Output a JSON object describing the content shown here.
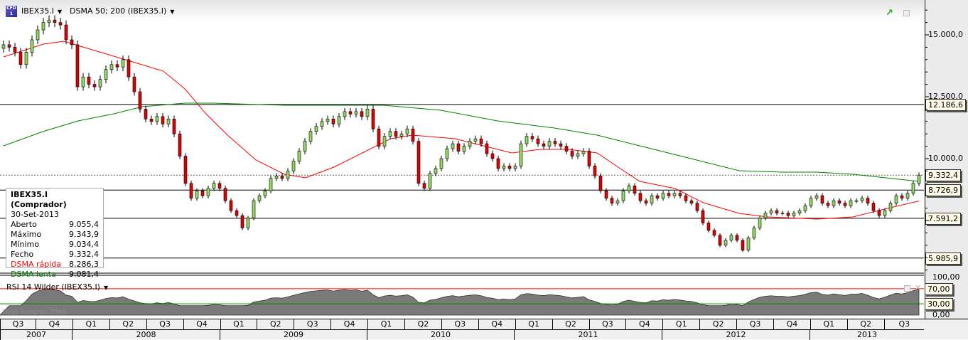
{
  "header": {
    "symbol": "IBEX35.I",
    "indicator": "DSMA 50; 200 (IBEX35.I)",
    "icon": "cfd-icon"
  },
  "infobox": {
    "title": "IBEX35.I (Comprador)",
    "date": "30-Set-2013",
    "rows": [
      {
        "label": "Aberto",
        "value": "9.055,4"
      },
      {
        "label": "Máximo",
        "value": "9.343,9"
      },
      {
        "label": "Mínimo",
        "value": "9.034,4"
      },
      {
        "label": "Fecho",
        "value": "9.332,4"
      },
      {
        "label": "DSMA rápida",
        "value": "8.286,3",
        "color": "#ff0000"
      },
      {
        "label": "DSMA lenta",
        "value": "9.081,4",
        "color": "#008000"
      }
    ]
  },
  "rsi": {
    "title": "RSI 14 Wilder (IBEX35.I)",
    "timezone": "Fuso horário: TMG",
    "axis": [
      "100,00",
      "0,00"
    ],
    "levels": [
      {
        "value": 70,
        "label": "70,00",
        "color": "#ff0000"
      },
      {
        "value": 30,
        "label": "30,00",
        "color": "#008000"
      }
    ]
  },
  "time_axis": {
    "quarters": [
      "Q3",
      "Q4",
      "Q1",
      "Q2",
      "Q3",
      "Q4",
      "Q1",
      "Q2",
      "Q3",
      "Q4",
      "Q1",
      "Q2",
      "Q3",
      "Q4",
      "Q1",
      "Q2",
      "Q3",
      "Q4",
      "Q1",
      "Q2",
      "Q3",
      "Q4",
      "Q1",
      "Q2",
      "Q3"
    ],
    "years": [
      "2007",
      "2008",
      "2009",
      "2010",
      "2011",
      "2012",
      "2013"
    ]
  },
  "chart_data": {
    "type": "candlestick",
    "interval": "biweekly (approx.)",
    "y_ticks": [
      {
        "value": 15000,
        "label": "15.000,0"
      },
      {
        "value": 12500,
        "label": "12.500,0"
      },
      {
        "value": 10000,
        "label": "10.000,0"
      }
    ],
    "horizontal_lines": [
      {
        "value": 12186.6,
        "label": "12.186,6"
      },
      {
        "value": 8726.9,
        "label": "8.726,9"
      },
      {
        "value": 7591.2,
        "label": "7.591,2"
      },
      {
        "value": 5985.9,
        "label": "5.985,9"
      }
    ],
    "last_price": {
      "value": 9332.4,
      "label": "9.332,4"
    },
    "closes": [
      14600,
      14500,
      14300,
      13800,
      14300,
      14800,
      15200,
      15500,
      15600,
      15500,
      15400,
      14800,
      14600,
      12900,
      13300,
      13000,
      12900,
      13200,
      13600,
      13800,
      13700,
      14000,
      13300,
      12700,
      12000,
      11600,
      11500,
      11700,
      11400,
      11600,
      11000,
      10100,
      9000,
      8400,
      8700,
      8500,
      8800,
      9000,
      8800,
      8300,
      7900,
      7700,
      7200,
      7600,
      8300,
      8500,
      8700,
      9200,
      9300,
      9200,
      9500,
      9900,
      10300,
      10700,
      11100,
      11300,
      11500,
      11600,
      11400,
      11700,
      11900,
      11800,
      11900,
      11700,
      12000,
      11200,
      10500,
      10900,
      11100,
      10900,
      11000,
      11200,
      10700,
      9000,
      8800,
      9400,
      9600,
      10000,
      10400,
      10600,
      10300,
      10500,
      10700,
      10800,
      10600,
      10200,
      10000,
      9600,
      9700,
      9600,
      9700,
      10600,
      10900,
      10800,
      10600,
      10500,
      10700,
      10600,
      10500,
      10300,
      10100,
      10200,
      10300,
      9700,
      9300,
      8700,
      8400,
      8200,
      8300,
      8700,
      8900,
      8600,
      8300,
      8200,
      8500,
      8400,
      8600,
      8500,
      8600,
      8500,
      8300,
      8200,
      7900,
      7400,
      7100,
      6900,
      6500,
      6700,
      6900,
      6700,
      6300,
      6800,
      7200,
      7600,
      7800,
      7900,
      7800,
      7800,
      7700,
      7800,
      7900,
      8100,
      8400,
      8500,
      8200,
      8100,
      8300,
      8200,
      8100,
      8300,
      8300,
      8400,
      8200,
      7900,
      7700,
      7900,
      8200,
      8500,
      8400,
      8600,
      9000,
      9332
    ],
    "series": [
      {
        "name": "DSMA rápida",
        "color": "#ff0000",
        "points": [
          [
            0,
            14110
          ],
          [
            7,
            14627
          ],
          [
            10.6,
            14742
          ],
          [
            15.6,
            14397
          ],
          [
            21.9,
            13966
          ],
          [
            28.1,
            13534
          ],
          [
            31.9,
            12816
          ],
          [
            35.6,
            11810
          ],
          [
            39.4,
            10948
          ],
          [
            44.4,
            9943
          ],
          [
            49.4,
            9368
          ],
          [
            53.1,
            9224
          ],
          [
            58.1,
            9655
          ],
          [
            63.1,
            10230
          ],
          [
            68.1,
            10805
          ],
          [
            71.9,
            10948
          ],
          [
            79.4,
            10805
          ],
          [
            86.9,
            10374
          ],
          [
            89.4,
            10230
          ],
          [
            94.4,
            10374
          ],
          [
            99.4,
            10374
          ],
          [
            104.4,
            10230
          ],
          [
            108.1,
            9655
          ],
          [
            111.9,
            9080
          ],
          [
            118.1,
            8793
          ],
          [
            123.1,
            8218
          ],
          [
            129.4,
            7787
          ],
          [
            134.4,
            7643
          ],
          [
            143.1,
            7557
          ],
          [
            149.4,
            7643
          ],
          [
            154.4,
            7931
          ],
          [
            161,
            8286
          ]
        ]
      },
      {
        "name": "DSMA lenta",
        "color": "#008000",
        "points": [
          [
            0,
            10517
          ],
          [
            6.9,
            11092
          ],
          [
            13.1,
            11523
          ],
          [
            19.4,
            11810
          ],
          [
            24.4,
            12098
          ],
          [
            31.9,
            12242
          ],
          [
            36.9,
            12242
          ],
          [
            49.4,
            12155
          ],
          [
            66.9,
            12155
          ],
          [
            76.9,
            11954
          ],
          [
            86.9,
            11523
          ],
          [
            96.9,
            11236
          ],
          [
            104.4,
            10948
          ],
          [
            111.9,
            10517
          ],
          [
            121.9,
            9943
          ],
          [
            129.4,
            9511
          ],
          [
            136.9,
            9454
          ],
          [
            143.1,
            9454
          ],
          [
            149.4,
            9368
          ],
          [
            161,
            9081
          ]
        ]
      }
    ],
    "colors": {
      "up": "#90d860",
      "down": "#e00000",
      "wick": "#000000"
    }
  }
}
